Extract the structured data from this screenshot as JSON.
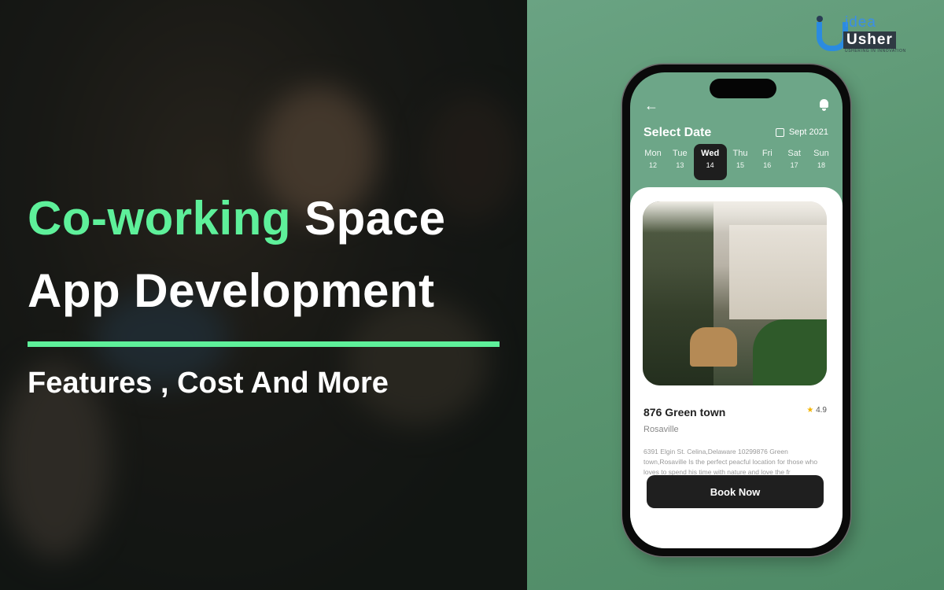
{
  "banner": {
    "headline_accent": "Co-working",
    "headline_rest": "Space",
    "headline_line2": "App Development",
    "subtitle": "Features , Cost And More",
    "accent_color": "#5ef09a"
  },
  "logo": {
    "brand_top": "idea",
    "brand_bottom": "Usher",
    "tagline": "USHERING IN INNOVATION"
  },
  "app": {
    "back_icon": "arrow-left-icon",
    "notification_icon": "bell-icon",
    "title": "Select Date",
    "month": "Sept 2021",
    "days": [
      {
        "name": "Mon",
        "date": "12"
      },
      {
        "name": "Tue",
        "date": "13"
      },
      {
        "name": "Wed",
        "date": "14"
      },
      {
        "name": "Thu",
        "date": "15"
      },
      {
        "name": "Fri",
        "date": "16"
      },
      {
        "name": "Sat",
        "date": "17"
      },
      {
        "name": "Sun",
        "date": "18"
      }
    ],
    "selected_day": "Wed",
    "listing": {
      "name": "876 Green town",
      "rating": "4.9",
      "city": "Rosaville",
      "description": "6391 Elgin St. Celina,Delaware 10299876 Green town,Rosaville Is the perfect peacful location for those who loves to spend his time with nature and love the fr"
    },
    "book_button": "Book Now"
  }
}
